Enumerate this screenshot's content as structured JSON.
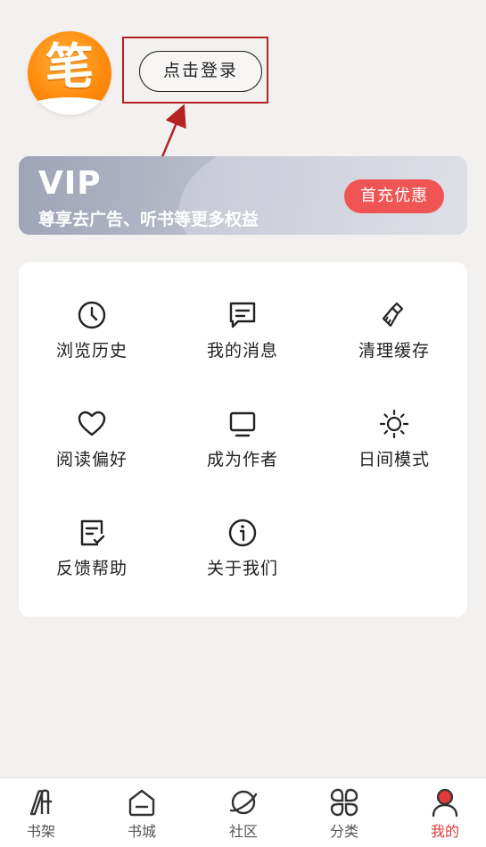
{
  "header": {
    "avatar_glyph": "笔",
    "login_label": "点击登录"
  },
  "vip": {
    "title": "VIP",
    "subtitle": "尊享去广告、听书等更多权益",
    "button_label": "首充优惠"
  },
  "menu": {
    "items": [
      {
        "label": "浏览历史",
        "icon": "clock-icon"
      },
      {
        "label": "我的消息",
        "icon": "message-icon"
      },
      {
        "label": "清理缓存",
        "icon": "brush-icon"
      },
      {
        "label": "阅读偏好",
        "icon": "heart-icon"
      },
      {
        "label": "成为作者",
        "icon": "monitor-icon"
      },
      {
        "label": "日间模式",
        "icon": "sun-icon"
      },
      {
        "label": "反馈帮助",
        "icon": "feedback-icon"
      },
      {
        "label": "关于我们",
        "icon": "info-icon"
      }
    ]
  },
  "tabbar": {
    "items": [
      {
        "label": "书架",
        "icon": "bookshelf-icon"
      },
      {
        "label": "书城",
        "icon": "bookstore-icon"
      },
      {
        "label": "社区",
        "icon": "community-icon"
      },
      {
        "label": "分类",
        "icon": "category-icon"
      },
      {
        "label": "我的",
        "icon": "profile-icon",
        "active": true
      }
    ]
  },
  "colors": {
    "accent": "#e23a3a",
    "vip_button": "#f05555",
    "annotation": "#b52222",
    "avatar_orange": "#ff8a0c"
  }
}
